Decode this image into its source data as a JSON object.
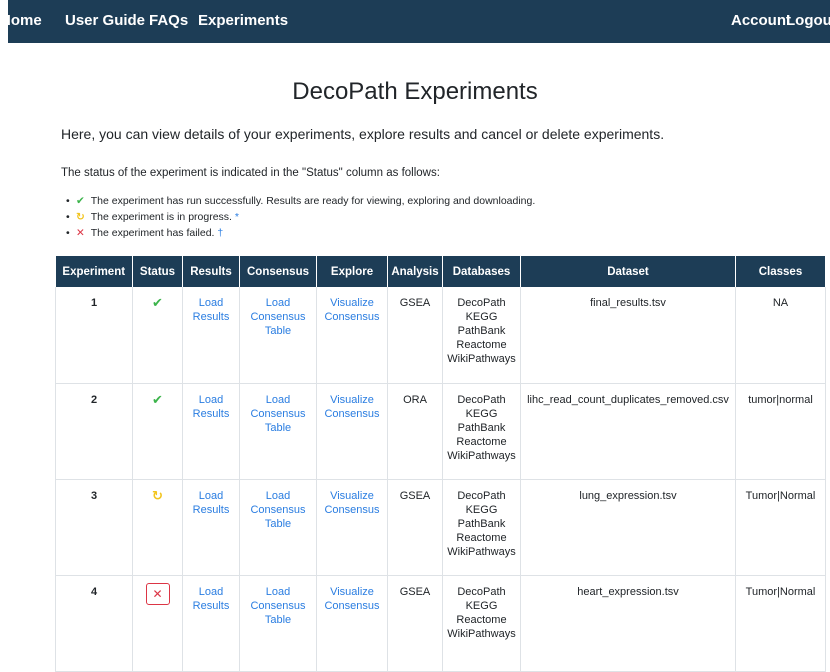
{
  "nav": {
    "left": [
      "Home",
      "User Guide",
      "FAQs",
      "Experiments"
    ],
    "right": [
      "Account",
      "Logout"
    ]
  },
  "page": {
    "title": "DecoPath Experiments",
    "intro": "Here, you can view details of your experiments, explore results and cancel or delete experiments.",
    "status_note": "The status of the experiment is indicated in the \"Status\" column as follows:"
  },
  "legend": [
    {
      "icon": "check-icon",
      "text": "The experiment has run successfully. Results are ready for viewing, exploring and downloading.",
      "mark": ""
    },
    {
      "icon": "in-progress-icon",
      "text": "The experiment is in progress.",
      "mark": "*"
    },
    {
      "icon": "failed-icon",
      "text": "The experiment has failed.",
      "mark": "†"
    }
  ],
  "table": {
    "headers": [
      "Experiment",
      "Status",
      "Results",
      "Consensus",
      "Explore",
      "Analysis",
      "Databases",
      "Dataset",
      "Classes"
    ],
    "rows": [
      {
        "experiment": "1",
        "status": "success",
        "results": "Load Results",
        "consensus": "Load Consensus Table",
        "explore": "Visualize Consensus",
        "analysis": "GSEA",
        "databases": [
          "DecoPath",
          "KEGG",
          "PathBank",
          "Reactome",
          "WikiPathways"
        ],
        "dataset": "final_results.tsv",
        "classes": "NA"
      },
      {
        "experiment": "2",
        "status": "success",
        "results": "Load Results",
        "consensus": "Load Consensus Table",
        "explore": "Visualize Consensus",
        "analysis": "ORA",
        "databases": [
          "DecoPath",
          "KEGG",
          "PathBank",
          "Reactome",
          "WikiPathways"
        ],
        "dataset": "lihc_read_count_duplicates_removed.csv",
        "classes": "tumor|normal"
      },
      {
        "experiment": "3",
        "status": "in-progress",
        "results": "Load Results",
        "consensus": "Load Consensus Table",
        "explore": "Visualize Consensus",
        "analysis": "GSEA",
        "databases": [
          "DecoPath",
          "KEGG",
          "PathBank",
          "Reactome",
          "WikiPathways"
        ],
        "dataset": "lung_expression.tsv",
        "classes": "Tumor|Normal"
      },
      {
        "experiment": "4",
        "status": "failed",
        "results": "Load Results",
        "consensus": "Load Consensus Table",
        "explore": "Visualize Consensus",
        "analysis": "GSEA",
        "databases": [
          "DecoPath",
          "KEGG",
          "Reactome",
          "WikiPathways"
        ],
        "dataset": "heart_expression.tsv",
        "classes": "Tumor|Normal"
      }
    ]
  },
  "colors": {
    "navbar": "#1d3d56",
    "link": "#2a7de1",
    "success": "#3cb44b",
    "progress": "#f2c41d",
    "failed": "#dc3545"
  }
}
